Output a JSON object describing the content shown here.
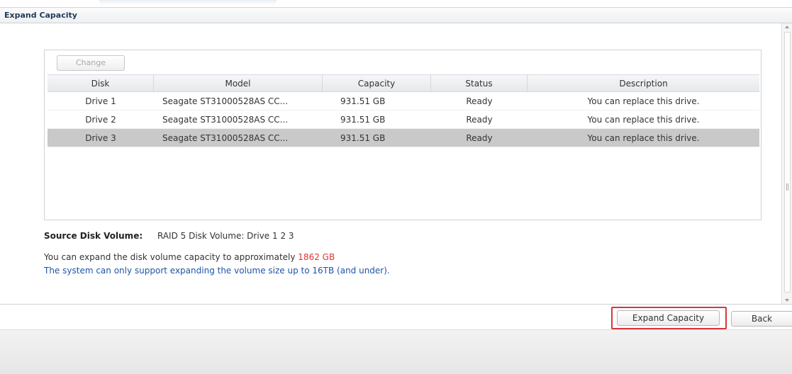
{
  "window": {
    "title": "Expand Capacity"
  },
  "toolbar": {
    "change_label": "Change"
  },
  "grid": {
    "columns": [
      "Disk",
      "Model",
      "Capacity",
      "Status",
      "Description"
    ],
    "rows": [
      {
        "disk": "Drive 1",
        "model": "Seagate ST31000528AS CC...",
        "capacity": "931.51 GB",
        "status": "Ready",
        "description": "You can replace this drive."
      },
      {
        "disk": "Drive 2",
        "model": "Seagate ST31000528AS CC...",
        "capacity": "931.51 GB",
        "status": "Ready",
        "description": "You can replace this drive."
      },
      {
        "disk": "Drive 3",
        "model": "Seagate ST31000528AS CC...",
        "capacity": "931.51 GB",
        "status": "Ready",
        "description": "You can replace this drive."
      }
    ],
    "selected_row": "Drive 3"
  },
  "info": {
    "source_label": "Source Disk Volume:",
    "source_value": "RAID 5 Disk Volume: Drive 1 2 3",
    "expand_text": "You can expand the disk volume capacity to approximately",
    "expand_value": "1862 GB",
    "limit_text": "The system can only support expanding the volume size up to 16TB (and under)."
  },
  "footer": {
    "expand_label": "Expand Capacity",
    "back_label": "Back"
  },
  "colors": {
    "highlight_red": "#e03434",
    "link_blue": "#1e54a8",
    "focus_border": "#d7363a",
    "selected_row": "#c9c9c9"
  }
}
